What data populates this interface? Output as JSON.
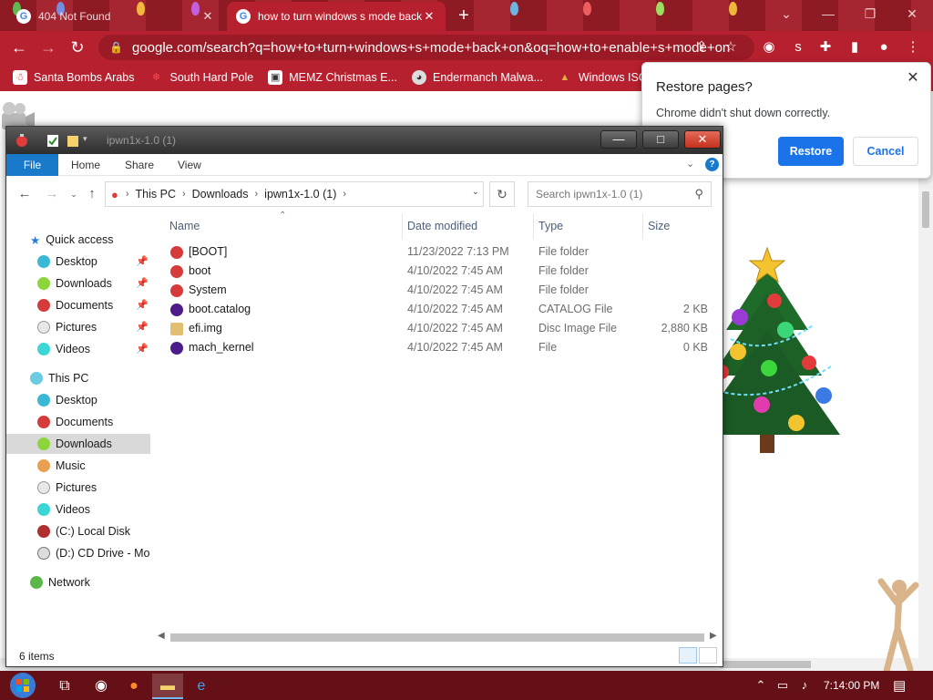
{
  "browser": {
    "tabs": [
      {
        "title": "404 Not Found",
        "active": false
      },
      {
        "title": "how to turn windows s mode back on",
        "active": true
      }
    ],
    "address": "google.com/search?q=how+to+turn+windows+s+mode+back+on&oq=how+to+enable+s+mode+on",
    "bookmarks": [
      {
        "label": "Santa Bombs Arabs",
        "icon": "snowman-icon"
      },
      {
        "label": "South Hard Pole",
        "icon": "snowflake-icon"
      },
      {
        "label": "MEMZ Christmas E...",
        "icon": "app-icon"
      },
      {
        "label": "Endermanch Malwa...",
        "icon": "wolf-icon"
      },
      {
        "label": "Windows ISOs",
        "icon": "tree-icon"
      }
    ],
    "accent": "#b7202e",
    "restore_dialog": {
      "title": "Restore pages?",
      "message": "Chrome didn't shut down correctly.",
      "restore_label": "Restore",
      "cancel_label": "Cancel"
    }
  },
  "explorer": {
    "title": "ipwn1x-1.0 (1)",
    "ribbon_tabs": [
      "File",
      "Home",
      "Share",
      "View"
    ],
    "breadcrumb": [
      "This PC",
      "Downloads",
      "ipwn1x-1.0 (1)"
    ],
    "search_placeholder": "Search ipwn1x-1.0 (1)",
    "columns": [
      "Name",
      "Date modified",
      "Type",
      "Size"
    ],
    "files": [
      {
        "name": "[BOOT]",
        "date": "11/23/2022 7:13 PM",
        "type": "File folder",
        "size": "",
        "icon": "ornament-red-icon"
      },
      {
        "name": "boot",
        "date": "4/10/2022 7:45 AM",
        "type": "File folder",
        "size": "",
        "icon": "ornament-red-icon"
      },
      {
        "name": "System",
        "date": "4/10/2022 7:45 AM",
        "type": "File folder",
        "size": "",
        "icon": "ornament-red-icon"
      },
      {
        "name": "boot.catalog",
        "date": "4/10/2022 7:45 AM",
        "type": "CATALOG File",
        "size": "2 KB",
        "icon": "ornament-purple-icon"
      },
      {
        "name": "efi.img",
        "date": "4/10/2022 7:45 AM",
        "type": "Disc Image File",
        "size": "2,880 KB",
        "icon": "disc-image-icon"
      },
      {
        "name": "mach_kernel",
        "date": "4/10/2022 7:45 AM",
        "type": "File",
        "size": "0 KB",
        "icon": "ornament-purple-icon"
      }
    ],
    "nav": {
      "quick_access": "Quick access",
      "quick_items": [
        "Desktop",
        "Downloads",
        "Documents",
        "Pictures",
        "Videos"
      ],
      "this_pc": "This PC",
      "pc_items": [
        "Desktop",
        "Documents",
        "Downloads",
        "Music",
        "Pictures",
        "Videos",
        "(C:) Local Disk",
        "(D:) CD Drive - More"
      ],
      "network": "Network"
    },
    "status": "6 items"
  },
  "taskbar": {
    "clock": "7:14:00 PM",
    "apps": [
      "task-view-icon",
      "chrome-icon",
      "firefox-icon",
      "file-explorer-icon",
      "internet-explorer-icon"
    ]
  }
}
